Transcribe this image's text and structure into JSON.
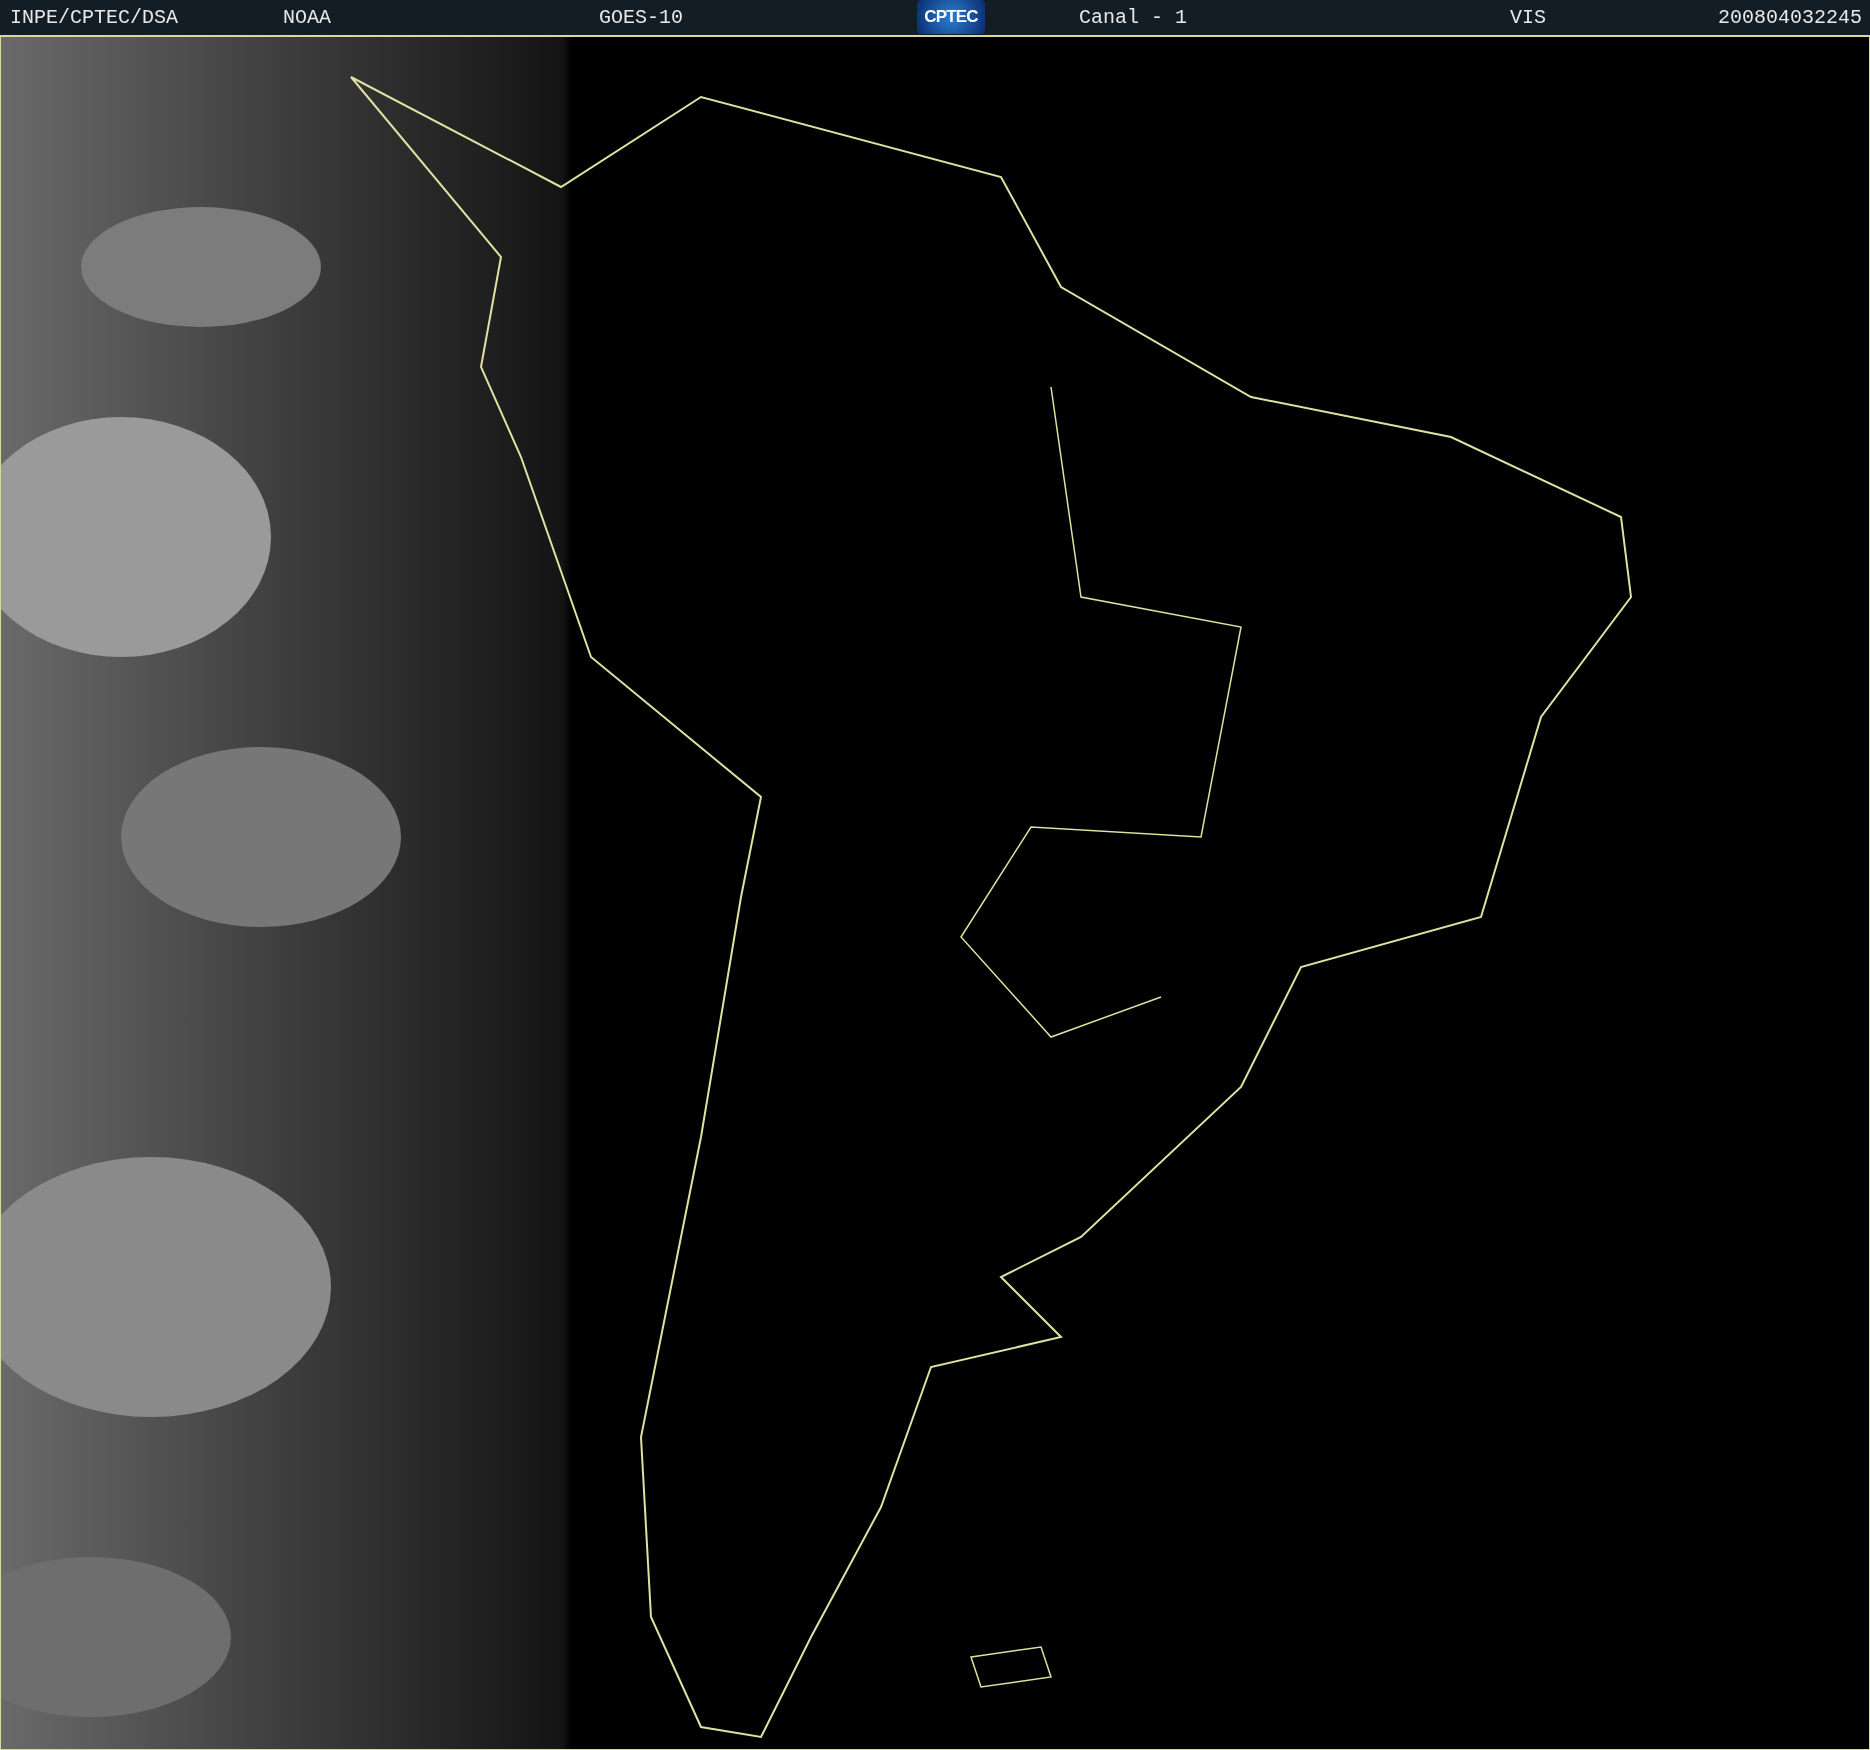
{
  "header": {
    "items": [
      {
        "kind": "text",
        "text": "INPE/CPTEC/DSA"
      },
      {
        "kind": "text",
        "text": "NOAA"
      },
      {
        "kind": "text",
        "text": "GOES-10"
      },
      {
        "kind": "logo",
        "text": "CPTEC"
      },
      {
        "kind": "text",
        "text": "Canal - 1"
      },
      {
        "kind": "text",
        "text": "VIS"
      },
      {
        "kind": "text",
        "text": "200804032245"
      }
    ]
  }
}
